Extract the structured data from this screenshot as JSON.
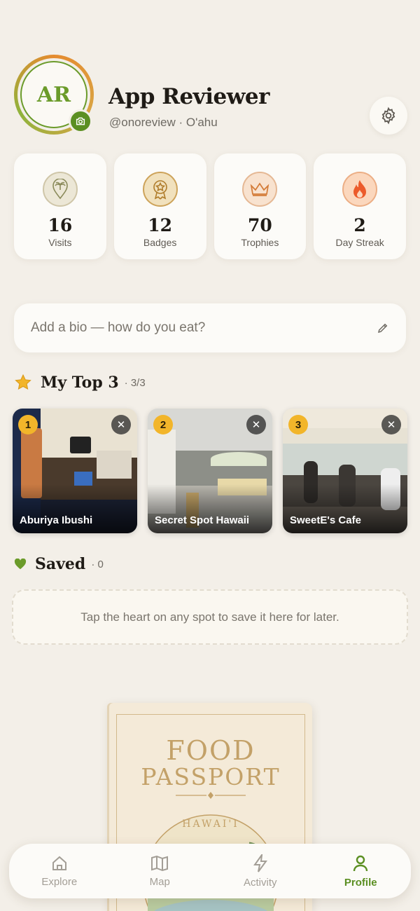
{
  "profile": {
    "initials": "AR",
    "name": "App Reviewer",
    "handle": "@onoreview · O'ahu"
  },
  "stats": [
    {
      "value": "16",
      "label": "Visits",
      "icon": "map-pin-palm-icon"
    },
    {
      "value": "12",
      "label": "Badges",
      "icon": "star-medal-icon"
    },
    {
      "value": "70",
      "label": "Trophies",
      "icon": "crown-icon"
    },
    {
      "value": "2",
      "label": "Day Streak",
      "icon": "flame-icon"
    }
  ],
  "bio": {
    "placeholder": "Add a bio — how do you eat?"
  },
  "top3": {
    "title": "My Top 3",
    "count": "· 3/3",
    "items": [
      {
        "rank": "1",
        "name": "Aburiya Ibushi"
      },
      {
        "rank": "2",
        "name": "Secret Spot Hawaii"
      },
      {
        "rank": "3",
        "name": "SweetE's Cafe"
      }
    ]
  },
  "saved": {
    "title": "Saved",
    "count": "· 0",
    "empty_text": "Tap the heart on any spot to save it here for later."
  },
  "passport": {
    "line1": "FOOD",
    "line2": "PASSPORT",
    "region": "HAWAI'I"
  },
  "nav": {
    "items": [
      {
        "label": "Explore",
        "icon": "home-icon"
      },
      {
        "label": "Map",
        "icon": "map-icon"
      },
      {
        "label": "Activity",
        "icon": "lightning-icon"
      },
      {
        "label": "Profile",
        "icon": "person-icon"
      }
    ],
    "active": "Profile"
  },
  "colors": {
    "background": "#f3efe8",
    "accent_green": "#5b8f22",
    "rank_gold": "#f2b52a"
  }
}
